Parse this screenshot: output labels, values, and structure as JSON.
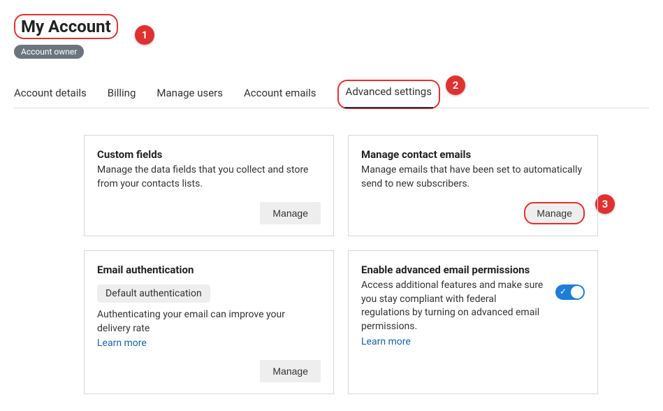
{
  "header": {
    "title": "My Account",
    "role_badge": "Account owner"
  },
  "annotations": {
    "a1": "1",
    "a2": "2",
    "a3": "3"
  },
  "tabs": {
    "t0": "Account details",
    "t1": "Billing",
    "t2": "Manage users",
    "t3": "Account emails",
    "t4": "Advanced settings"
  },
  "cards": {
    "custom_fields": {
      "title": "Custom fields",
      "desc": "Manage the data fields that you collect and store from your contacts lists.",
      "button": "Manage"
    },
    "contact_emails": {
      "title": "Manage contact emails",
      "desc": "Manage emails that have been set to automatically send to new subscribers.",
      "button": "Manage"
    },
    "email_auth": {
      "title": "Email authentication",
      "pill": "Default authentication",
      "desc": "Authenticating your email can improve your delivery rate",
      "learn": "Learn more",
      "button": "Manage"
    },
    "advanced_perms": {
      "title": "Enable advanced email permissions",
      "desc": "Access additional features and make sure you stay compliant with federal regulations by turning on advanced email permissions.",
      "learn": "Learn more"
    }
  }
}
